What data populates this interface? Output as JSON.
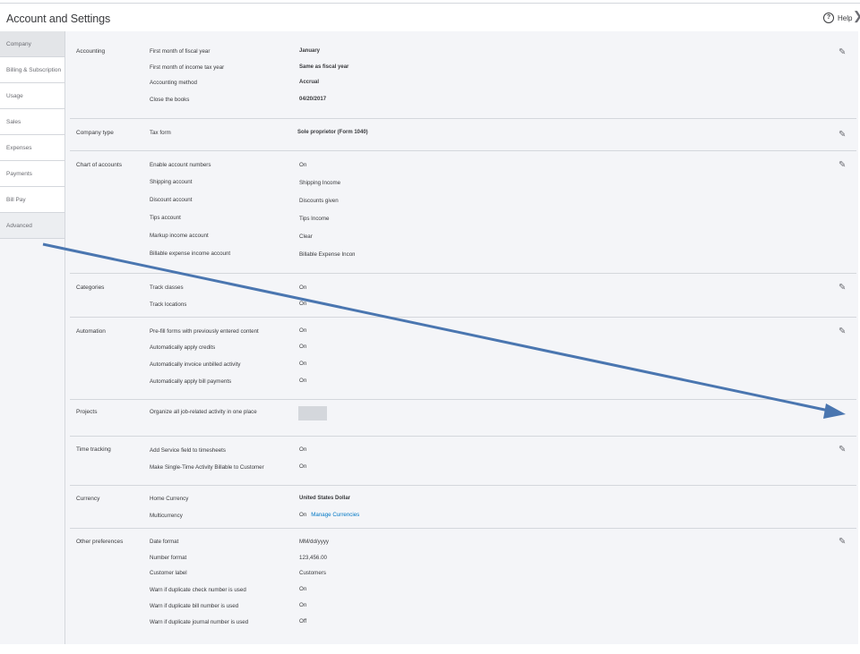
{
  "header": {
    "title": "Account and Settings",
    "help_label": "Help",
    "help_icon": "?",
    "close_icon": "❯"
  },
  "sidebar": {
    "items": [
      {
        "label": "Company"
      },
      {
        "label": "Billing & Subscription"
      },
      {
        "label": "Usage"
      },
      {
        "label": "Sales"
      },
      {
        "label": "Expenses"
      },
      {
        "label": "Payments"
      },
      {
        "label": "Bill Pay"
      },
      {
        "label": "Advanced"
      }
    ],
    "active_index": 0
  },
  "sections": {
    "accounting": {
      "label": "Accounting",
      "rows": [
        {
          "label": "First month of fiscal year",
          "value": "January"
        },
        {
          "label": "First month of income tax year",
          "value": "Same as fiscal year"
        },
        {
          "label": "Accounting method",
          "value": "Accrual"
        },
        {
          "label": "Close the books",
          "value": "04/20/2017"
        }
      ]
    },
    "company_type": {
      "label": "Company type",
      "rows": [
        {
          "label": "Tax form",
          "value": "Sole proprietor (Form 1040)"
        }
      ]
    },
    "chart_of_accounts": {
      "label": "Chart of accounts",
      "rows": [
        {
          "label": "Enable account numbers",
          "value": "On"
        },
        {
          "label": "Shipping account",
          "value": "Shipping Income"
        },
        {
          "label": "Discount account",
          "value": "Discounts given"
        },
        {
          "label": "Tips account",
          "value": "Tips Income"
        },
        {
          "label": "Markup income account",
          "value": "Clear"
        },
        {
          "label": "Billable expense income account",
          "value": "Billable Expense Income"
        }
      ]
    },
    "categories": {
      "label": "Categories",
      "rows": [
        {
          "label": "Track classes",
          "value": "On"
        },
        {
          "label": "Track locations",
          "value": "On"
        }
      ]
    },
    "automation": {
      "label": "Automation",
      "rows": [
        {
          "label": "Pre-fill forms with previously entered content",
          "value": "On"
        },
        {
          "label": "Automatically apply credits",
          "value": "On"
        },
        {
          "label": "Automatically invoice unbilled activity",
          "value": "On"
        },
        {
          "label": "Automatically apply bill payments",
          "value": "On"
        }
      ]
    },
    "projects": {
      "label": "Projects",
      "rows": [
        {
          "label": "Organize all job-related activity in one place",
          "value": ""
        }
      ]
    },
    "time_tracking": {
      "label": "Time tracking",
      "rows": [
        {
          "label": "Add Service field to timesheets",
          "value": "On"
        },
        {
          "label": "Make Single-Time Activity Billable to Customer",
          "value": "On"
        }
      ]
    },
    "currency": {
      "label": "Currency",
      "rows": [
        {
          "label": "Home Currency",
          "value": "United States Dollar"
        },
        {
          "label": "Multicurrency",
          "value": "On",
          "link": "Manage Currencies"
        }
      ]
    },
    "other_preferences": {
      "label": "Other preferences",
      "rows": [
        {
          "label": "Date format",
          "value": "MM/dd/yyyy"
        },
        {
          "label": "Number format",
          "value": "123,456.00"
        },
        {
          "label": "Customer label",
          "value": "Customers"
        },
        {
          "label": "Warn if duplicate check number is used",
          "value": "On"
        },
        {
          "label": "Warn if duplicate bill number is used",
          "value": "On"
        },
        {
          "label": "Warn if duplicate journal number is used",
          "value": "Off"
        }
      ]
    }
  },
  "icons": {
    "edit": "pencil-icon"
  },
  "colors": {
    "arrow": "#4a76b0",
    "link": "#0077c5",
    "sidebar_active": "#e3e5e8"
  }
}
